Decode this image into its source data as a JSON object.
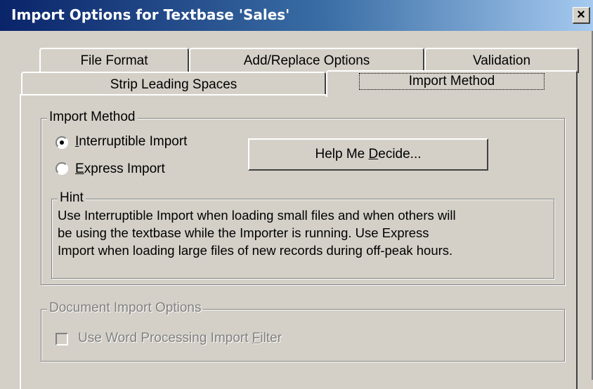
{
  "window": {
    "title": "Import Options for Textbase 'Sales'",
    "close_glyph": "×"
  },
  "tabs": {
    "row1": [
      "File Format",
      "Add/Replace Options",
      "Validation"
    ],
    "row2": [
      "Strip Leading Spaces",
      "Import Method"
    ],
    "selected": "Import Method"
  },
  "import_method": {
    "group_label": "Import Method",
    "options": [
      {
        "label_pre": "",
        "mnemonic": "I",
        "label_post": "nterruptible Import",
        "checked": true
      },
      {
        "label_pre": "",
        "mnemonic": "E",
        "label_post": "xpress Import",
        "checked": false
      }
    ],
    "help_button": {
      "label_pre": "Help Me ",
      "mnemonic": "D",
      "label_post": "ecide..."
    }
  },
  "hint": {
    "label": "Hint",
    "lines": [
      "Use Interruptible Import when loading small files and when others will",
      "be using the textbase while the Importer is running. Use Express",
      "Import when loading large files of new records during off-peak hours."
    ]
  },
  "document_options": {
    "group_label": "Document Import Options",
    "checkbox": {
      "label_pre": "Use Word Processing Import ",
      "mnemonic": "F",
      "label_post": "ilter",
      "checked": false,
      "enabled": false
    }
  },
  "colors": {
    "face": "#d4d0c8",
    "title_start": "#0a246a",
    "title_end": "#a6caf0",
    "disabled_text": "#808080"
  }
}
